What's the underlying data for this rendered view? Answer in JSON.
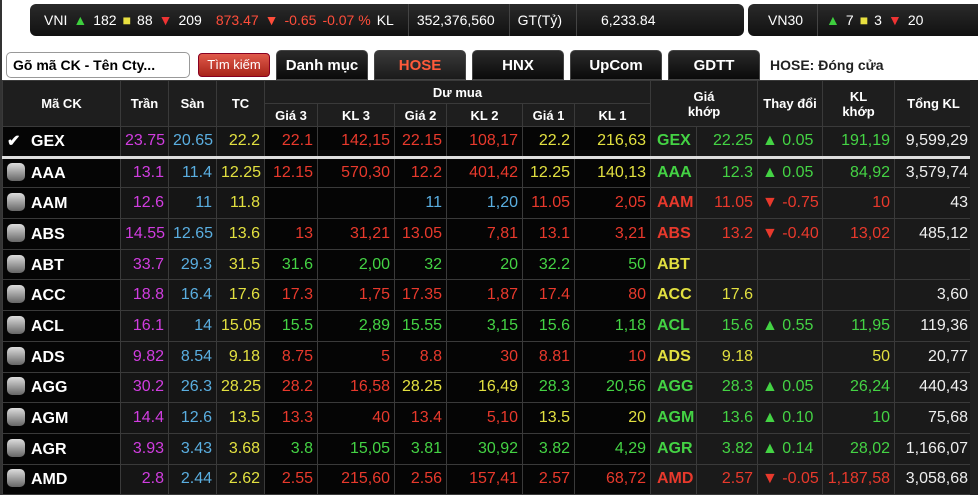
{
  "index_bar": {
    "vni": {
      "label": "VNI",
      "up": "182",
      "ref": "88",
      "down": "209",
      "value": "873.47",
      "change": "-0.65",
      "pct": "-0.07 %",
      "kl_label": "KL",
      "kl": "352,376,560",
      "gt_label": "GT(Tỷ)",
      "gt": "6,233.84"
    },
    "vn30": {
      "label": "VN30",
      "up": "7",
      "ref": "3",
      "down": "20"
    }
  },
  "toolbar": {
    "search_placeholder": "Gõ mã CK - Tên Cty...",
    "search_button": "Tìm kiếm",
    "tabs": [
      "Danh mục",
      "HOSE",
      "HNX",
      "UpCom",
      "GDTT"
    ],
    "active_tab": "HOSE",
    "status": "HOSE:  Đóng cửa"
  },
  "headers": {
    "symbol": "Mã CK",
    "ceiling": "Trần",
    "floor": "Sàn",
    "ref": "TC",
    "bid_group": "Dư mua",
    "bid_cols": [
      "Giá 3",
      "KL 3",
      "Giá 2",
      "KL 2",
      "Giá 1",
      "KL 1"
    ],
    "match_price": "Giá khớp",
    "change": "Thay đổi",
    "match_vol": "KL khớp",
    "total_vol": "Tổng KL"
  },
  "colors": {
    "m": "#d13de0",
    "b": "#5aaee0",
    "y": "#e2e040",
    "r": "#e8392c",
    "g": "#44d344",
    "w": "#eeeeee"
  },
  "rows": [
    {
      "sym": "GEX",
      "checked": true,
      "tran": "23.75",
      "san": "20.65",
      "tc": "22.2",
      "cells": [
        [
          "22.1",
          "r"
        ],
        [
          "142,15",
          "r"
        ],
        [
          "22.15",
          "r"
        ],
        [
          "108,17",
          "r"
        ],
        [
          "22.2",
          "y"
        ],
        [
          "216,63",
          "y"
        ],
        [
          "GEX",
          "g"
        ],
        [
          "22.25",
          "g"
        ],
        [
          "0.05",
          "g"
        ],
        [
          "191,19",
          "g"
        ],
        [
          "9,599,29",
          "w"
        ]
      ],
      "dir": "up"
    },
    {
      "sym": "AAA",
      "tran": "13.1",
      "san": "11.4",
      "tc": "12.25",
      "cells": [
        [
          "12.15",
          "r"
        ],
        [
          "570,30",
          "r"
        ],
        [
          "12.2",
          "r"
        ],
        [
          "401,42",
          "r"
        ],
        [
          "12.25",
          "y"
        ],
        [
          "140,13",
          "y"
        ],
        [
          "AAA",
          "g"
        ],
        [
          "12.3",
          "g"
        ],
        [
          "0.05",
          "g"
        ],
        [
          "84,92",
          "g"
        ],
        [
          "3,579,74",
          "w"
        ]
      ],
      "dir": "up"
    },
    {
      "sym": "AAM",
      "tran": "12.6",
      "san": "11",
      "tc": "11.8",
      "cells": [
        [
          "",
          "w"
        ],
        [
          "",
          "w"
        ],
        [
          "11",
          "b"
        ],
        [
          "1,20",
          "b"
        ],
        [
          "11.05",
          "r"
        ],
        [
          "2,05",
          "r"
        ],
        [
          "AAM",
          "r"
        ],
        [
          "11.05",
          "r"
        ],
        [
          "-0.75",
          "r"
        ],
        [
          "10",
          "r"
        ],
        [
          "43",
          "w"
        ]
      ],
      "dir": "down"
    },
    {
      "sym": "ABS",
      "tran": "14.55",
      "san": "12.65",
      "tc": "13.6",
      "cells": [
        [
          "13",
          "r"
        ],
        [
          "31,21",
          "r"
        ],
        [
          "13.05",
          "r"
        ],
        [
          "7,81",
          "r"
        ],
        [
          "13.1",
          "r"
        ],
        [
          "3,21",
          "r"
        ],
        [
          "ABS",
          "r"
        ],
        [
          "13.2",
          "r"
        ],
        [
          "-0.40",
          "r"
        ],
        [
          "13,02",
          "r"
        ],
        [
          "485,12",
          "w"
        ]
      ],
      "dir": "down"
    },
    {
      "sym": "ABT",
      "tran": "33.7",
      "san": "29.3",
      "tc": "31.5",
      "cells": [
        [
          "31.6",
          "g"
        ],
        [
          "2,00",
          "g"
        ],
        [
          "32",
          "g"
        ],
        [
          "20",
          "g"
        ],
        [
          "32.2",
          "g"
        ],
        [
          "50",
          "g"
        ],
        [
          "ABT",
          "y"
        ],
        [
          "",
          "w"
        ],
        [
          "",
          "w"
        ],
        [
          "",
          "w"
        ],
        [
          "",
          "w"
        ]
      ],
      "dir": ""
    },
    {
      "sym": "ACC",
      "tran": "18.8",
      "san": "16.4",
      "tc": "17.6",
      "cells": [
        [
          "17.3",
          "r"
        ],
        [
          "1,75",
          "r"
        ],
        [
          "17.35",
          "r"
        ],
        [
          "1,87",
          "r"
        ],
        [
          "17.4",
          "r"
        ],
        [
          "80",
          "r"
        ],
        [
          "ACC",
          "y"
        ],
        [
          "17.6",
          "y"
        ],
        [
          "",
          "w"
        ],
        [
          "",
          "w"
        ],
        [
          "3,60",
          "w"
        ]
      ],
      "dir": ""
    },
    {
      "sym": "ACL",
      "tran": "16.1",
      "san": "14",
      "tc": "15.05",
      "cells": [
        [
          "15.5",
          "g"
        ],
        [
          "2,89",
          "g"
        ],
        [
          "15.55",
          "g"
        ],
        [
          "3,15",
          "g"
        ],
        [
          "15.6",
          "g"
        ],
        [
          "1,18",
          "g"
        ],
        [
          "ACL",
          "g"
        ],
        [
          "15.6",
          "g"
        ],
        [
          "0.55",
          "g"
        ],
        [
          "11,95",
          "g"
        ],
        [
          "119,36",
          "w"
        ]
      ],
      "dir": "up"
    },
    {
      "sym": "ADS",
      "tran": "9.82",
      "san": "8.54",
      "tc": "9.18",
      "cells": [
        [
          "8.75",
          "r"
        ],
        [
          "5",
          "r"
        ],
        [
          "8.8",
          "r"
        ],
        [
          "30",
          "r"
        ],
        [
          "8.81",
          "r"
        ],
        [
          "10",
          "r"
        ],
        [
          "ADS",
          "y"
        ],
        [
          "9.18",
          "y"
        ],
        [
          "",
          "w"
        ],
        [
          "50",
          "y"
        ],
        [
          "20,77",
          "w"
        ]
      ],
      "dir": ""
    },
    {
      "sym": "AGG",
      "tran": "30.2",
      "san": "26.3",
      "tc": "28.25",
      "cells": [
        [
          "28.2",
          "r"
        ],
        [
          "16,58",
          "r"
        ],
        [
          "28.25",
          "y"
        ],
        [
          "16,49",
          "y"
        ],
        [
          "28.3",
          "g"
        ],
        [
          "20,56",
          "g"
        ],
        [
          "AGG",
          "g"
        ],
        [
          "28.3",
          "g"
        ],
        [
          "0.05",
          "g"
        ],
        [
          "26,24",
          "g"
        ],
        [
          "440,43",
          "w"
        ]
      ],
      "dir": "up"
    },
    {
      "sym": "AGM",
      "tran": "14.4",
      "san": "12.6",
      "tc": "13.5",
      "cells": [
        [
          "13.3",
          "r"
        ],
        [
          "40",
          "r"
        ],
        [
          "13.4",
          "r"
        ],
        [
          "5,10",
          "r"
        ],
        [
          "13.5",
          "y"
        ],
        [
          "20",
          "y"
        ],
        [
          "AGM",
          "g"
        ],
        [
          "13.6",
          "g"
        ],
        [
          "0.10",
          "g"
        ],
        [
          "10",
          "g"
        ],
        [
          "75,68",
          "w"
        ]
      ],
      "dir": "up"
    },
    {
      "sym": "AGR",
      "tran": "3.93",
      "san": "3.43",
      "tc": "3.68",
      "cells": [
        [
          "3.8",
          "g"
        ],
        [
          "15,05",
          "g"
        ],
        [
          "3.81",
          "g"
        ],
        [
          "30,92",
          "g"
        ],
        [
          "3.82",
          "g"
        ],
        [
          "4,29",
          "g"
        ],
        [
          "AGR",
          "g"
        ],
        [
          "3.82",
          "g"
        ],
        [
          "0.14",
          "g"
        ],
        [
          "28,02",
          "g"
        ],
        [
          "1,166,07",
          "w"
        ]
      ],
      "dir": "up"
    },
    {
      "sym": "AMD",
      "tran": "2.8",
      "san": "2.44",
      "tc": "2.62",
      "cells": [
        [
          "2.55",
          "r"
        ],
        [
          "215,60",
          "r"
        ],
        [
          "2.56",
          "r"
        ],
        [
          "157,41",
          "r"
        ],
        [
          "2.57",
          "r"
        ],
        [
          "68,72",
          "r"
        ],
        [
          "AMD",
          "r"
        ],
        [
          "2.57",
          "r"
        ],
        [
          "-0.05",
          "r"
        ],
        [
          "1,187,58",
          "r"
        ],
        [
          "3,058,68",
          "w"
        ]
      ],
      "dir": "down"
    }
  ]
}
